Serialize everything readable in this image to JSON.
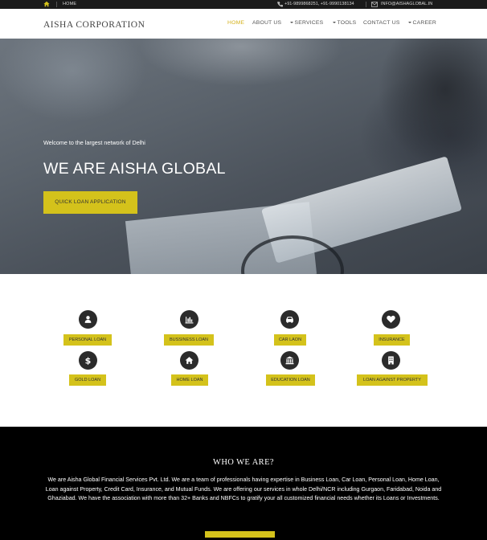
{
  "topbar": {
    "home_link": "HOME",
    "phone": "+91-9899868251, +91-9990138134",
    "email": "INFO@AISHAGLOBAL.IN"
  },
  "nav": {
    "brand": "AISHA CORPORATION",
    "items": [
      {
        "label": "HOME",
        "active": true
      },
      {
        "label": "ABOUT US"
      },
      {
        "label": "SERVICES",
        "dropdown": true
      },
      {
        "label": "TOOLS",
        "dropdown": true
      },
      {
        "label": "CONTACT US"
      },
      {
        "label": "CAREER",
        "dropdown": true
      }
    ]
  },
  "hero": {
    "subtitle": "Welcome to the largest network of Delhi",
    "title": "WE ARE AISHA GLOBAL",
    "button": "QUICK LOAN APPLICATION"
  },
  "services": [
    {
      "label": "PERSONAL LOAN",
      "icon": "user-icon"
    },
    {
      "label": "BUSSINESS LOAN",
      "icon": "bar-chart-icon"
    },
    {
      "label": "CAR LAON",
      "icon": "car-icon"
    },
    {
      "label": "INSURANCE",
      "icon": "heart-icon"
    },
    {
      "label": "GOLD LOAN",
      "icon": "dollar-icon"
    },
    {
      "label": "HOME LOAN",
      "icon": "home-icon"
    },
    {
      "label": "EDUCATION LOAN",
      "icon": "bank-icon"
    },
    {
      "label": "LOAN AGAINST PROPERTY",
      "icon": "building-icon"
    }
  ],
  "who": {
    "title": "WHO WE ARE?",
    "text": "We are Aisha Global Financial Services Pvt. Ltd. We are a team of professionals having expertise in Business Loan, Car Loan, Personal Loan, Home Loan, Loan against Property, Credit Card, Insurance, and Mutual Funds. We are offering our services in whole Delhi/NCR including Gurgaon, Faridabad, Noida and Ghaziabad. We have the association with more than 32+ Banks and NBFCs to gratify your all customized financial needs whether its Loans or Investments."
  },
  "colors": {
    "accent": "#d4c21b",
    "dark": "#000000"
  }
}
